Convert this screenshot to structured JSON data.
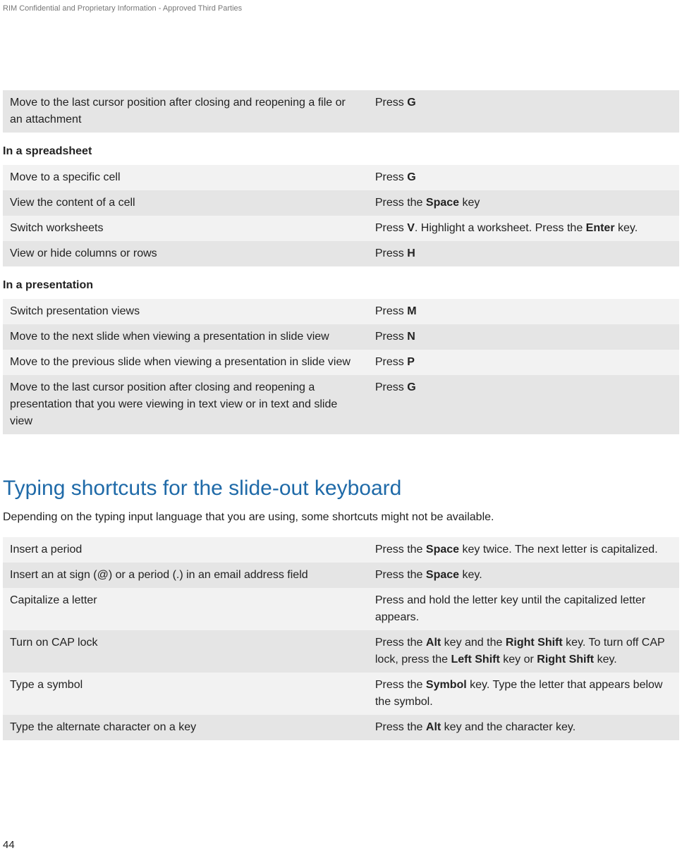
{
  "header_note": "RIM Confidential and Proprietary Information - Approved Third Parties",
  "table0": {
    "rows": [
      {
        "desc": "Move to the last cursor position after closing and reopening a file or an attachment",
        "act_pre": "Press ",
        "act_b1": "G",
        "act_post": ""
      }
    ]
  },
  "section_spreadsheet": "In a spreadsheet",
  "table_spreadsheet": {
    "rows": [
      {
        "desc": "Move to a specific cell",
        "act_pre": "Press ",
        "act_b1": "G",
        "act_post": ""
      },
      {
        "desc": "View the content of a cell",
        "act_pre": "Press the ",
        "act_b1": "Space",
        "act_post": " key"
      },
      {
        "desc": "Switch worksheets",
        "act_pre": "Press ",
        "act_b1": "V",
        "act_mid": ". Highlight a worksheet. Press the ",
        "act_b2": "Enter",
        "act_post": " key."
      },
      {
        "desc": "View or hide columns or rows",
        "act_pre": "Press ",
        "act_b1": "H",
        "act_post": ""
      }
    ]
  },
  "section_presentation": "In a presentation",
  "table_presentation": {
    "rows": [
      {
        "desc": "Switch presentation views",
        "act_pre": "Press ",
        "act_b1": "M",
        "act_post": ""
      },
      {
        "desc": "Move to the next slide when viewing a presentation in slide view",
        "act_pre": "Press ",
        "act_b1": "N",
        "act_post": ""
      },
      {
        "desc": "Move to the previous slide when viewing a presentation in slide view",
        "act_pre": "Press ",
        "act_b1": "P",
        "act_post": ""
      },
      {
        "desc": "Move to the last cursor position after closing and reopening a presentation that you were viewing in text view or in text and slide view",
        "act_pre": "Press ",
        "act_b1": "G",
        "act_post": ""
      }
    ]
  },
  "title": "Typing shortcuts for the slide-out keyboard",
  "intro": "Depending on the typing input language that you are using, some shortcuts might not be available.",
  "table_typing": {
    "rows": [
      {
        "desc": "Insert a period",
        "act_pre": "Press the ",
        "act_b1": "Space",
        "act_post": " key twice. The next letter is capitalized."
      },
      {
        "desc": "Insert an at sign (@) or a period (.) in an email address field",
        "act_pre": "Press the ",
        "act_b1": "Space",
        "act_post": " key."
      },
      {
        "desc": "Capitalize a letter",
        "act_plain": "Press and hold the letter key until the capitalized letter appears."
      },
      {
        "desc": "Turn on CAP lock",
        "act_pre": "Press the ",
        "act_b1": "Alt",
        "act_mid": " key and the ",
        "act_b2": "Right Shift",
        "act_mid2": " key. To turn off CAP lock, press the ",
        "act_b3": "Left Shift",
        "act_mid3": " key or ",
        "act_b4": "Right Shift",
        "act_post": " key."
      },
      {
        "desc": "Type a symbol",
        "act_pre": "Press the ",
        "act_b1": "Symbol",
        "act_post": " key. Type the letter that appears below the symbol."
      },
      {
        "desc": "Type the alternate character on a key",
        "act_pre": "Press the ",
        "act_b1": "Alt",
        "act_post": " key and the character key."
      }
    ]
  },
  "page_number": "44"
}
